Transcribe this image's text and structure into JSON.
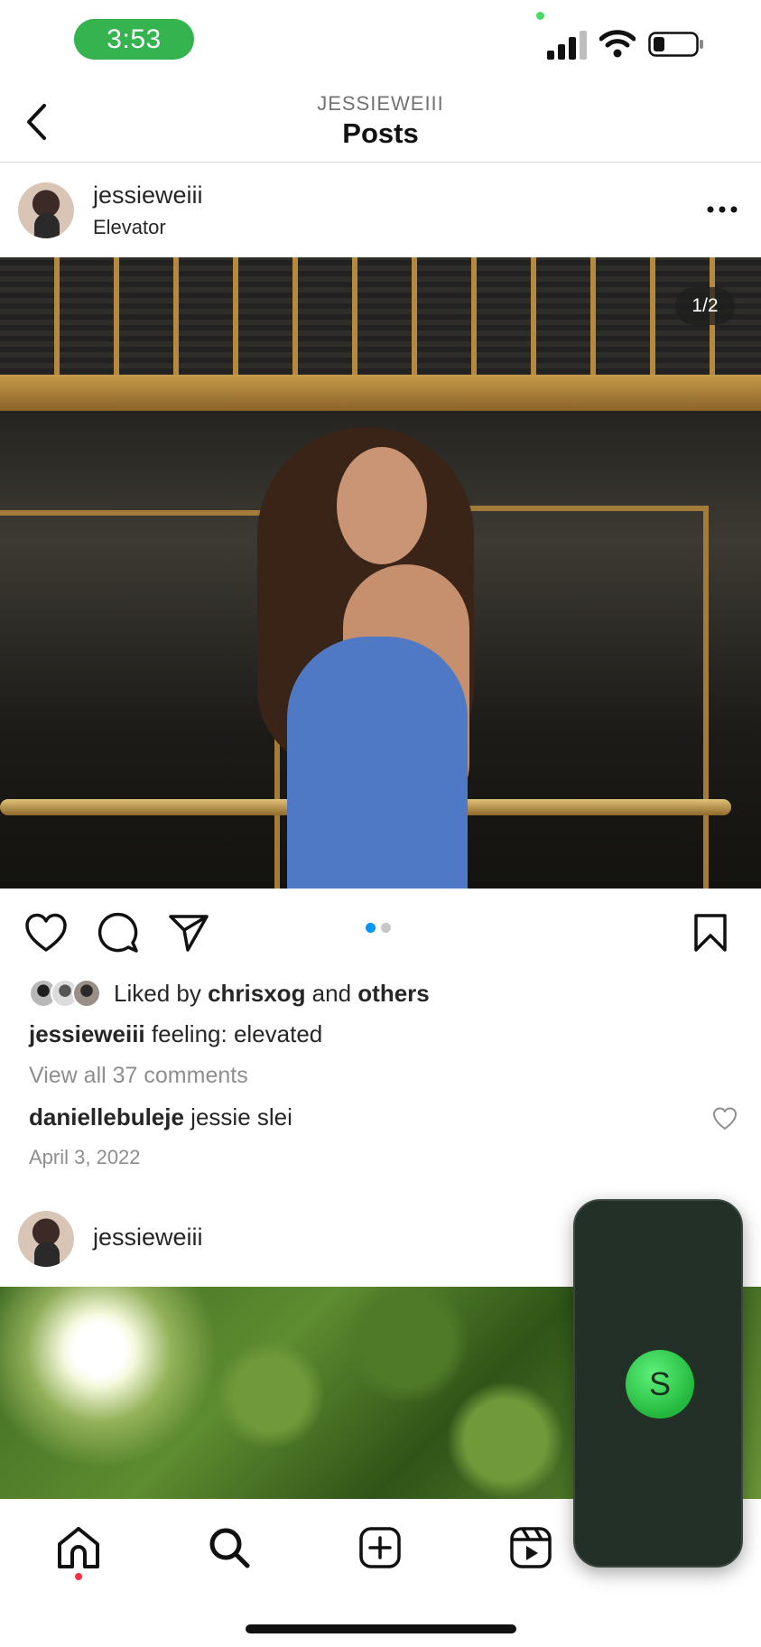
{
  "status": {
    "time": "3:53",
    "icons": [
      "signal-icon",
      "wifi-icon",
      "battery-icon"
    ]
  },
  "header": {
    "account": "JESSIEWEIII",
    "title": "Posts"
  },
  "post": {
    "username": "jessieweiii",
    "location": "Elevator",
    "counter": "1/2",
    "liked_by_prefix": "Liked by ",
    "liked_by_user": "chrisxog",
    "liked_by_and": " and ",
    "liked_by_others": "others",
    "caption_user": "jessieweiii",
    "caption_text": " feeling: elevated",
    "view_comments": "View all 37 comments",
    "comment_user": "daniellebuleje",
    "comment_text": " jessie slei",
    "date": "April 3, 2022",
    "carousel": {
      "count": 2,
      "active": 1
    }
  },
  "post2": {
    "username": "jessieweiii"
  },
  "float_call": {
    "initial": "S"
  },
  "colors": {
    "time_pill": "#34b34f",
    "active_dot": "#0095f6",
    "notify_dot": "#ff3040",
    "float_panel": "#233027"
  }
}
